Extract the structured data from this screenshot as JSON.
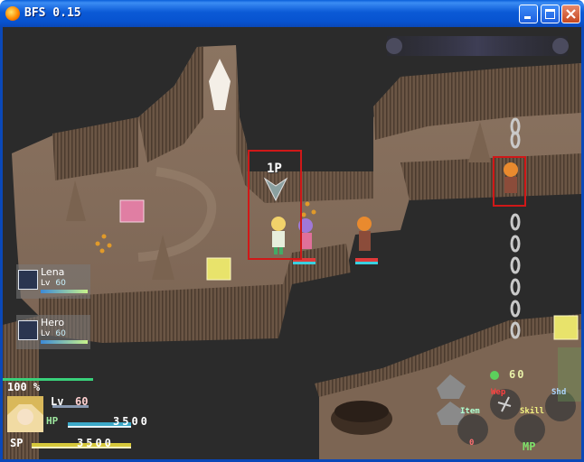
{
  "window": {
    "title": "BFS  0.15"
  },
  "hud": {
    "player_marker": "1P",
    "party": [
      {
        "name": "Lena",
        "lv_label": "Lv",
        "level": "60"
      },
      {
        "name": "Hero",
        "lv_label": "Lv",
        "level": "60"
      }
    ],
    "gauge_percent": "100 %",
    "status": {
      "lv_label": "Lv",
      "level": "60",
      "hp_label": "HP",
      "hp": "3500",
      "sp_label": "SP",
      "sp": "3500"
    },
    "gold": "60",
    "commands": {
      "weapon": "Wep",
      "shield": "Shd",
      "item": "Item",
      "skill": "Skill",
      "mp": "MP",
      "item_count": "0"
    }
  }
}
